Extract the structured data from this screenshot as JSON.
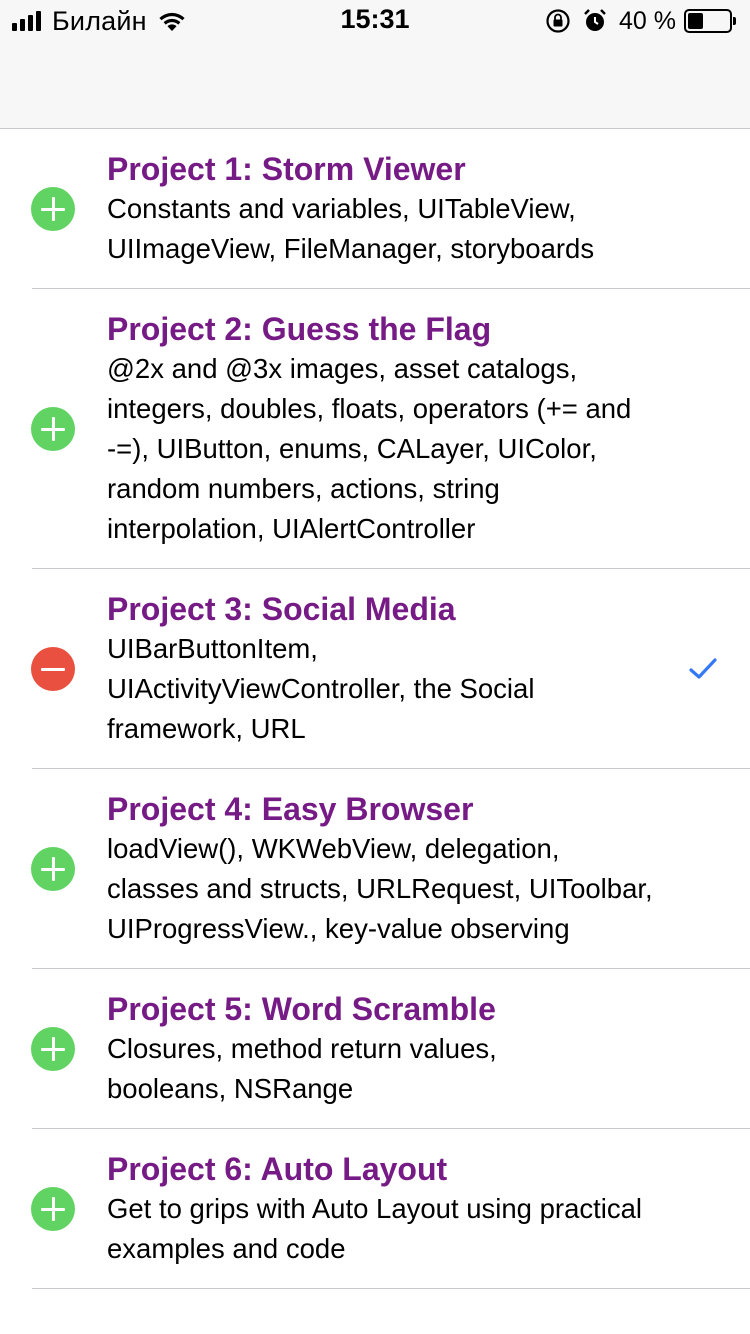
{
  "status_bar": {
    "carrier": "Билайн",
    "time": "15:31",
    "battery_text": "40 %",
    "battery_level": 0.4,
    "icons": [
      "signal-icon",
      "wifi-icon",
      "rotation-lock-icon",
      "alarm-icon",
      "battery-icon"
    ]
  },
  "colors": {
    "title": "#761a85",
    "insert": "#61d363",
    "delete": "#e9503f",
    "checkmark": "#3478f6"
  },
  "projects": [
    {
      "title": "Project 1: Storm Viewer",
      "lines": [
        "Constants and variables, UITableView,",
        "UIImageView, FileManager, storyboards"
      ],
      "control": "insert",
      "checked": false
    },
    {
      "title": "Project 2: Guess the Flag",
      "lines": [
        "@2x and @3x images, asset catalogs,",
        "integers, doubles, floats, operators (+= and",
        "-=), UIButton, enums, CALayer, UIColor,",
        "random numbers, actions, string",
        "interpolation, UIAlertController"
      ],
      "control": "insert",
      "checked": false
    },
    {
      "title": "Project 3: Social Media",
      "lines": [
        "UIBarButtonItem,",
        "UIActivityViewController, the Social",
        "framework, URL"
      ],
      "control": "delete",
      "checked": true
    },
    {
      "title": "Project 4: Easy Browser",
      "lines": [
        "loadView(), WKWebView, delegation,",
        "classes and structs, URLRequest, UIToolbar,",
        "UIProgressView., key-value observing"
      ],
      "control": "insert",
      "checked": false
    },
    {
      "title": "Project 5: Word Scramble",
      "lines": [
        "Closures, method return values,",
        "booleans, NSRange"
      ],
      "control": "insert",
      "checked": false
    },
    {
      "title": "Project 6: Auto Layout",
      "lines": [
        "Get to grips with Auto Layout using practical",
        "examples and code"
      ],
      "control": "insert",
      "checked": false
    }
  ]
}
